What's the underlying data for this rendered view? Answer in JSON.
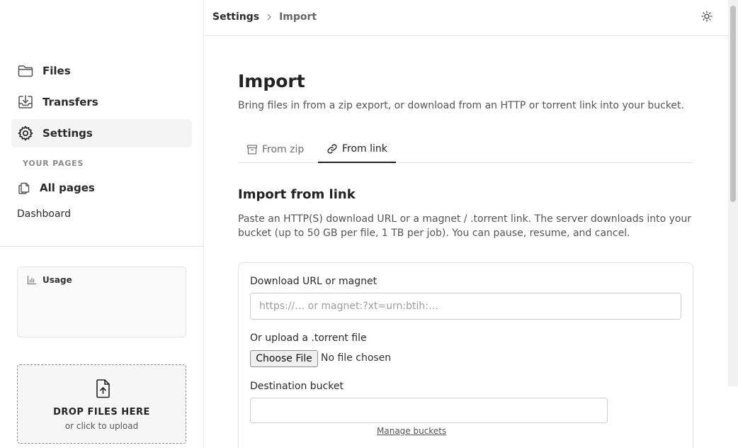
{
  "sidebar": {
    "nav": [
      {
        "label": "Files",
        "icon": "folder-icon"
      },
      {
        "label": "Transfers",
        "icon": "download-tray-icon"
      },
      {
        "label": "Settings",
        "icon": "gear-icon",
        "active": true
      }
    ],
    "section_label": "YOUR PAGES",
    "all_pages": "All pages",
    "dashboard": "Dashboard",
    "usage_title": "Usage",
    "drop_title": "DROP FILES HERE",
    "drop_subtitle": "or click to upload"
  },
  "header": {
    "breadcrumb": [
      "Settings",
      "Import"
    ]
  },
  "main": {
    "title": "Import",
    "description": "Bring files in from a zip export, or download from an HTTP or torrent link into your bucket.",
    "tabs": [
      {
        "label": "From zip",
        "icon": "archive-box-icon"
      },
      {
        "label": "From link",
        "icon": "link-icon",
        "active": true
      }
    ],
    "section_title": "Import from link",
    "section_description": "Paste an HTTP(S) download URL or a magnet / .torrent link. The server downloads into your bucket (up to 50 GB per file, 1 TB per job). You can pause, resume, and cancel.",
    "form": {
      "url_label": "Download URL or magnet",
      "url_placeholder": "https://… or magnet:?xt=urn:btih:…",
      "url_value": "",
      "torrent_label": "Or upload a .torrent file",
      "file_button": "Choose File",
      "file_status": "No file chosen",
      "bucket_label": "Destination bucket",
      "manage_link": "Manage buckets"
    }
  }
}
